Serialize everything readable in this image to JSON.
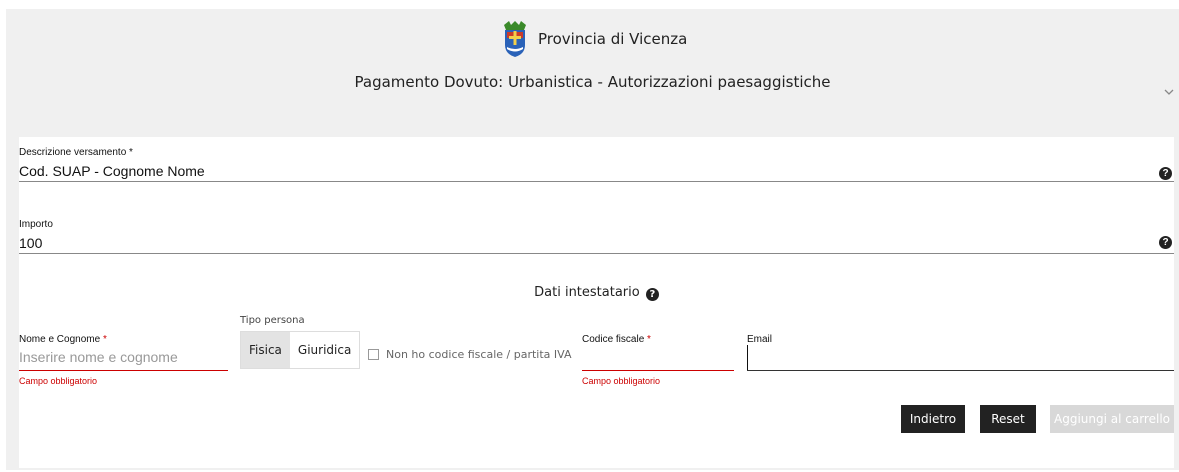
{
  "header": {
    "brand_name": "Provincia di Vicenza",
    "page_title": "Pagamento Dovuto: Urbanistica - Autorizzazioni paesaggistiche"
  },
  "form": {
    "descrizione": {
      "label": "Descrizione versamento",
      "required_mark": "*",
      "value": "Cod. SUAP - Cognome Nome",
      "help_icon": "question-circle-icon"
    },
    "importo": {
      "label": "Importo",
      "value": "100",
      "help_icon": "question-circle-icon"
    },
    "section_title": "Dati intestatario",
    "nome": {
      "label": "Nome e Cognome",
      "required_mark": "*",
      "placeholder": "Inserire nome e cognome",
      "value": "",
      "error": "Campo obbligatorio"
    },
    "tipo_persona": {
      "label": "Tipo persona",
      "options": [
        "Fisica",
        "Giuridica"
      ],
      "selected": "Fisica"
    },
    "no_cf_checkbox": {
      "label": "Non ho codice fiscale / partita IVA",
      "checked": false
    },
    "codice_fiscale": {
      "label": "Codice fiscale",
      "required_mark": "*",
      "value": "",
      "error": "Campo obbligatorio"
    },
    "email": {
      "label": "Email",
      "value": ""
    }
  },
  "actions": {
    "back": "Indietro",
    "reset": "Reset",
    "add_to_cart": "Aggiungi al carrello"
  },
  "colors": {
    "panel_bg": "#f0f0f0",
    "error": "#cc0000",
    "button_dark": "#222222",
    "button_disabled": "#d8d8d8"
  }
}
